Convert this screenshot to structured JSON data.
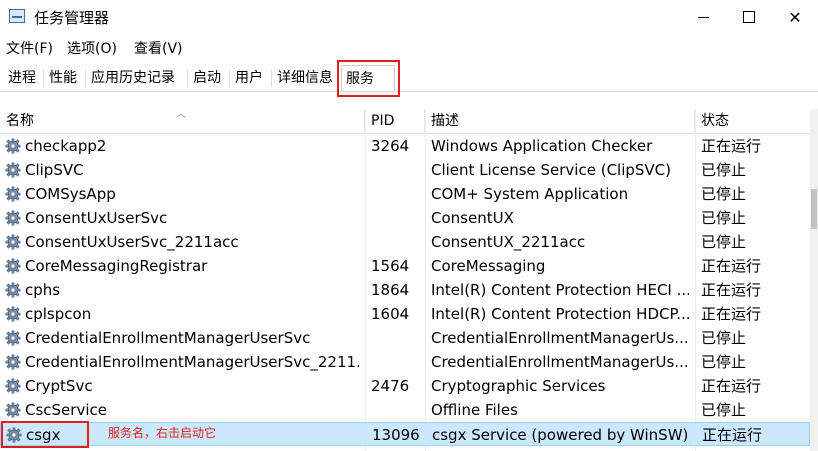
{
  "window": {
    "title": "任务管理器",
    "minimize": "minimize",
    "maximize": "maximize",
    "close": "close"
  },
  "menu": [
    "文件(F)",
    "选项(O)",
    "查看(V)"
  ],
  "tabs": [
    "进程",
    "性能",
    "应用历史记录",
    "启动",
    "用户",
    "详细信息",
    "服务"
  ],
  "active_tab": "服务",
  "columns": {
    "name": "名称",
    "pid": "PID",
    "desc": "描述",
    "status": "状态"
  },
  "rows": [
    {
      "name": "checkapp2",
      "pid": "3264",
      "desc": "Windows Application Checker",
      "status": "正在运行"
    },
    {
      "name": "ClipSVC",
      "pid": "",
      "desc": "Client License Service (ClipSVC)",
      "status": "已停止"
    },
    {
      "name": "COMSysApp",
      "pid": "",
      "desc": "COM+ System Application",
      "status": "已停止"
    },
    {
      "name": "ConsentUxUserSvc",
      "pid": "",
      "desc": "ConsentUX",
      "status": "已停止"
    },
    {
      "name": "ConsentUxUserSvc_2211acc",
      "pid": "",
      "desc": "ConsentUX_2211acc",
      "status": "已停止"
    },
    {
      "name": "CoreMessagingRegistrar",
      "pid": "1564",
      "desc": "CoreMessaging",
      "status": "正在运行"
    },
    {
      "name": "cphs",
      "pid": "1864",
      "desc": "Intel(R) Content Protection HECI ...",
      "status": "正在运行"
    },
    {
      "name": "cplspcon",
      "pid": "1604",
      "desc": "Intel(R) Content Protection HDCP...",
      "status": "正在运行"
    },
    {
      "name": "CredentialEnrollmentManagerUserSvc",
      "pid": "",
      "desc": "CredentialEnrollmentManagerUs...",
      "status": "已停止"
    },
    {
      "name": "CredentialEnrollmentManagerUserSvc_2211...",
      "pid": "",
      "desc": "CredentialEnrollmentManagerUs...",
      "status": "已停止"
    },
    {
      "name": "CryptSvc",
      "pid": "2476",
      "desc": "Cryptographic Services",
      "status": "正在运行"
    },
    {
      "name": "CscService",
      "pid": "",
      "desc": "Offline Files",
      "status": "已停止"
    },
    {
      "name": "csgx",
      "pid": "13096",
      "desc": "csgx Service (powered by WinSW)",
      "status": "正在运行"
    }
  ],
  "selected_row": 12,
  "annotation": "服务名，右击启动它",
  "colors": {
    "highlight_box": "#e02020",
    "selection_bg": "#cce8ff",
    "icon": "gear-icon"
  }
}
